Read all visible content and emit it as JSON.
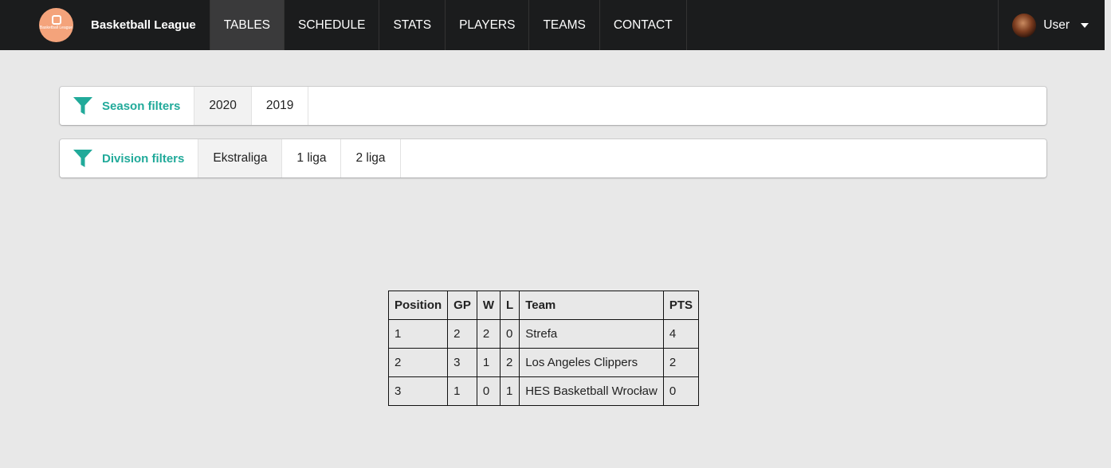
{
  "navbar": {
    "brand_name": "Basketball League",
    "logo_text": "Basketball League",
    "items": [
      {
        "label": "TABLES"
      },
      {
        "label": "SCHEDULE"
      },
      {
        "label": "STATS"
      },
      {
        "label": "PLAYERS"
      },
      {
        "label": "TEAMS"
      },
      {
        "label": "CONTACT"
      }
    ],
    "active_item": "TABLES",
    "user_label": "User"
  },
  "season_filters": {
    "title": "Season filters",
    "options": [
      "2020",
      "2019"
    ],
    "selected": "2020"
  },
  "division_filters": {
    "title": "Division filters",
    "options": [
      "Ekstraliga",
      "1 liga",
      "2 liga"
    ],
    "selected": "Ekstraliga"
  },
  "standings": {
    "headers": [
      "Position",
      "GP",
      "W",
      "L",
      "Team",
      "PTS"
    ],
    "rows": [
      [
        "1",
        "2",
        "2",
        "0",
        "Strefa",
        "4"
      ],
      [
        "2",
        "3",
        "1",
        "2",
        "Los Angeles Clippers",
        "2"
      ],
      [
        "3",
        "1",
        "0",
        "1",
        "HES Basketball Wrocław",
        "0"
      ]
    ]
  },
  "colors": {
    "navbar_bg": "#1b1c1d",
    "accent_teal": "#21aa9a",
    "logo_orange": "#f4a37b",
    "page_bg": "#e8e8e8"
  },
  "icons": {
    "filter": "filter-icon",
    "caret": "caret-down-icon",
    "avatar": "avatar"
  }
}
